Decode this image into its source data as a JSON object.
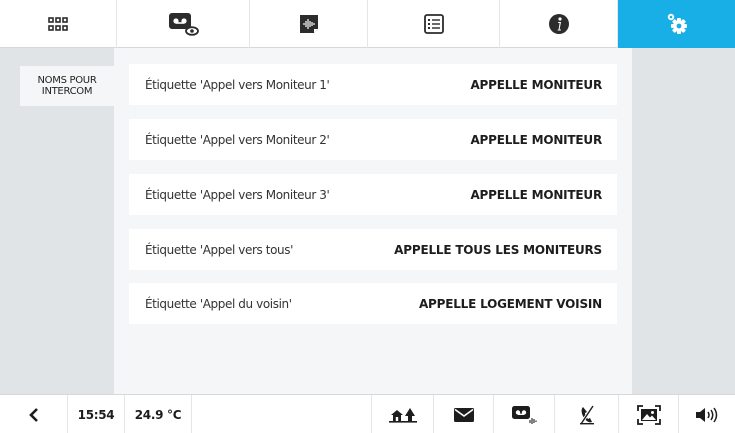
{
  "top_tabs": [
    {
      "icon": "apps-grid-icon",
      "active": false
    },
    {
      "icon": "videomessage-view-icon",
      "active": false
    },
    {
      "icon": "audio-message-icon",
      "active": false
    },
    {
      "icon": "list-icon",
      "active": false
    },
    {
      "icon": "info-icon",
      "active": false
    },
    {
      "icon": "settings-gears-icon",
      "active": true
    }
  ],
  "sidebar": {
    "items": [
      {
        "label": "NOMS POUR INTERCOM",
        "selected": true
      }
    ]
  },
  "settings": {
    "rows": [
      {
        "label": "Étiquette 'Appel vers Moniteur 1'",
        "value": "APPELLE MONITEUR"
      },
      {
        "label": "Étiquette 'Appel vers Moniteur 2'",
        "value": "APPELLE MONITEUR"
      },
      {
        "label": "Étiquette 'Appel vers Moniteur 3'",
        "value": "APPELLE MONITEUR"
      },
      {
        "label": "Étiquette 'Appel vers tous'",
        "value": "APPELLE TOUS LES MONITEURS"
      },
      {
        "label": "Étiquette 'Appel du voisin'",
        "value": "APPELLE LOGEMENT VOISIN"
      }
    ]
  },
  "statusbar": {
    "time": "15:54",
    "temperature": "24.9 °C",
    "icons": [
      "back-arrow-icon",
      "home-away-icon",
      "envelope-icon",
      "videomessage-icon",
      "call-muted-icon",
      "fullscreen-image-icon",
      "speaker-icon"
    ]
  },
  "colors": {
    "accent": "#18aee6",
    "panel_gray": "#e1e4e6",
    "content_bg": "#f5f6f7",
    "icon_dark": "#2c2c2c"
  }
}
